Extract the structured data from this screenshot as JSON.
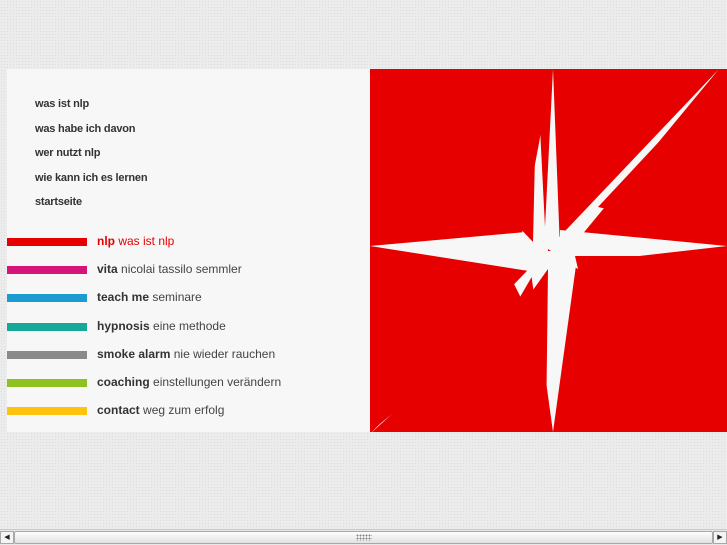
{
  "topnav": [
    {
      "label": "was ist nlp"
    },
    {
      "label": "was habe ich davon"
    },
    {
      "label": "wer nutzt nlp"
    },
    {
      "label": "wie kann ich es lernen"
    },
    {
      "label": "startseite"
    }
  ],
  "menu": [
    {
      "bold": "nlp",
      "rest": " was ist nlp",
      "color": "#e60000",
      "active": true
    },
    {
      "bold": "vita",
      "rest": " nicolai tassilo semmler",
      "color": "#d6157a"
    },
    {
      "bold": "teach me",
      "rest": " seminare",
      "color": "#1c9bd0"
    },
    {
      "bold": "hypnosis",
      "rest": " eine methode",
      "color": "#16a898"
    },
    {
      "bold": "smoke alarm",
      "rest": " nie wieder rauchen",
      "color": "#8a8a8a"
    },
    {
      "bold": "coaching",
      "rest": " einstellungen verändern",
      "color": "#8dc21f"
    },
    {
      "bold": "contact",
      "rest": " weg zum erfolg",
      "color": "#ffc20e"
    }
  ],
  "graphic": {
    "icon": "compass-star-icon",
    "red": "#e60000",
    "white": "#f7f7f7"
  },
  "scrollbar": {
    "left_icon": "◀",
    "right_icon": "▶"
  }
}
